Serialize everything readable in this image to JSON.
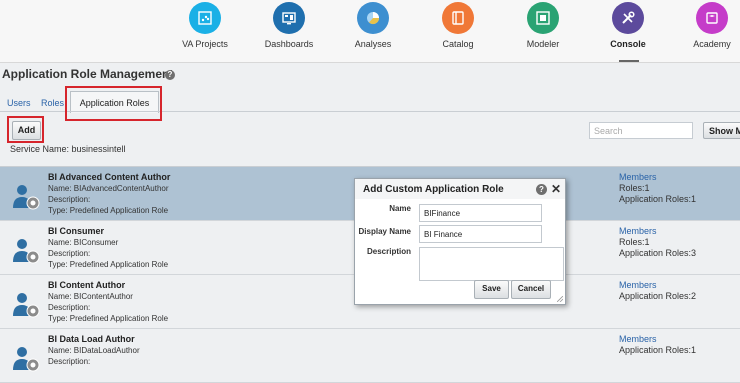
{
  "nav": [
    {
      "label": "VA Projects",
      "icon": "va-projects-icon",
      "color": "#1ab0e6",
      "active": false
    },
    {
      "label": "Dashboards",
      "icon": "dashboards-icon",
      "color": "#1f6fae",
      "active": false
    },
    {
      "label": "Analyses",
      "icon": "analyses-icon",
      "color": "#3d8fd0",
      "active": false
    },
    {
      "label": "Catalog",
      "icon": "catalog-icon",
      "color": "#f07837",
      "active": false
    },
    {
      "label": "Modeler",
      "icon": "modeler-icon",
      "color": "#2aa373",
      "active": false
    },
    {
      "label": "Console",
      "icon": "console-icon",
      "color": "#5c4a9c",
      "active": true
    },
    {
      "label": "Academy",
      "icon": "academy-icon",
      "color": "#c53cc9",
      "active": false
    }
  ],
  "page": {
    "title": "Application Role Management",
    "help": "?"
  },
  "tabs": {
    "users": "Users",
    "roles": "Roles",
    "application_roles": "Application Roles"
  },
  "toolbar": {
    "add_label": "Add",
    "service_name": "Service Name: businessintell",
    "search_placeholder": "Search",
    "show_members_label": "Show Members"
  },
  "roles": [
    {
      "name": "BI Advanced Content Author",
      "name_line": "Name: BIAdvancedContentAuthor",
      "desc_line": "Description:",
      "type_line": "Type: Predefined Application Role",
      "members": "Members",
      "roles": "Roles:1",
      "app_roles": "Application Roles:1"
    },
    {
      "name": "BI Consumer",
      "name_line": "Name: BIConsumer",
      "desc_line": "Description:",
      "type_line": "Type: Predefined Application Role",
      "members": "Members",
      "roles": "Roles:1",
      "app_roles": "Application Roles:3"
    },
    {
      "name": "BI Content Author",
      "name_line": "Name: BIContentAuthor",
      "desc_line": "Description:",
      "type_line": "Type: Predefined Application Role",
      "members": "Members",
      "roles": "",
      "app_roles": "Application Roles:2"
    },
    {
      "name": "BI Data Load Author",
      "name_line": "Name: BIDataLoadAuthor",
      "desc_line": "Description:",
      "type_line": "",
      "members": "Members",
      "roles": "",
      "app_roles": "Application Roles:1"
    }
  ],
  "dialog": {
    "title": "Add Custom Application Role",
    "help": "?",
    "close": "✕",
    "name_label": "Name",
    "name_value": "BIFinance",
    "display_label": "Display Name",
    "display_value": "BI Finance",
    "desc_label": "Description",
    "save_label": "Save",
    "cancel_label": "Cancel"
  },
  "colors": {
    "highlight": "#d6252c",
    "selected_row": "#aec2d3",
    "link": "#2a63a8"
  }
}
